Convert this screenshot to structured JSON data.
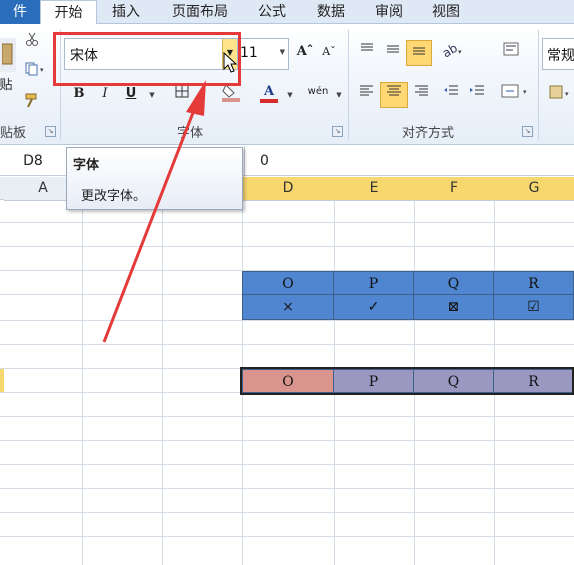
{
  "ribbon_tabs": [
    "件",
    "开始",
    "插入",
    "页面布局",
    "公式",
    "数据",
    "审阅",
    "视图"
  ],
  "font_group": {
    "font_name": "宋体",
    "font_size": "11",
    "grow_font": "Aˆ",
    "shrink_font": "Aˇ",
    "bold": "B",
    "italic": "I",
    "underline": "U",
    "font_color_letter": "A",
    "phonetic": "wén",
    "label": "字体"
  },
  "clipboard_group": {
    "label": "贴板",
    "paste_label": "贴"
  },
  "alignment_group": {
    "label": "对齐方式"
  },
  "number_group": {
    "format_value": "常规"
  },
  "formula_bar": {
    "name_box": "D8",
    "value": "0"
  },
  "tooltip": {
    "title": "字体",
    "description": "更改字体。"
  },
  "column_headers": [
    "A",
    "D",
    "E",
    "F",
    "G"
  ],
  "rows": {
    "blue_header": [
      "O",
      "P",
      "Q",
      "R"
    ],
    "blue_symbols": [
      "×",
      "✓",
      "⊠",
      "☑"
    ],
    "selected_row": [
      "O",
      "P",
      "Q",
      "R"
    ]
  },
  "colors": {
    "blue_fill": "#4f86cf",
    "pink_fill": "#d9958d",
    "purple_fill": "#9a97c0",
    "selected_header": "#f6d86f",
    "annotation_red": "#e53a3a"
  }
}
